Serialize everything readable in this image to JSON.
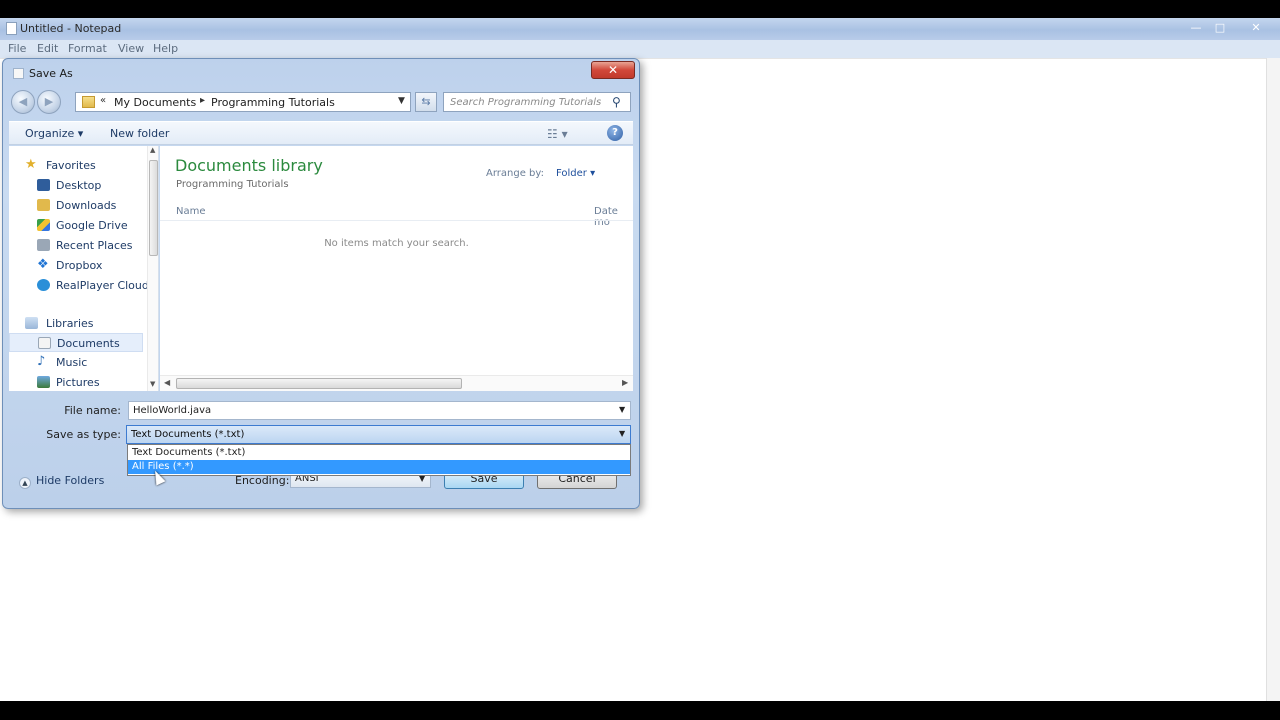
{
  "notepad": {
    "title": "Untitled - Notepad",
    "menu": [
      "File",
      "Edit",
      "Format",
      "View",
      "Help"
    ],
    "window_controls": {
      "minimize": "—",
      "maximize": "□",
      "close": "✕"
    }
  },
  "dialog": {
    "title": "Save As",
    "close_label": "✕",
    "address": {
      "prefix": "«",
      "segments": [
        "My Documents",
        "Programming Tutorials"
      ]
    },
    "search": {
      "placeholder": "Search Programming Tutorials"
    },
    "toolbar": {
      "organize": "Organize ▾",
      "new_folder": "New folder"
    },
    "nav": {
      "favorites_header": "Favorites",
      "favorites": [
        "Desktop",
        "Downloads",
        "Google Drive",
        "Recent Places",
        "Dropbox",
        "RealPlayer Cloud"
      ],
      "libraries_header": "Libraries",
      "libraries": [
        "Documents",
        "Music",
        "Pictures"
      ],
      "selected": "Documents"
    },
    "content": {
      "library_title": "Documents library",
      "library_subtitle": "Programming Tutorials",
      "arrange_label": "Arrange by:",
      "arrange_value": "Folder ▾",
      "columns": [
        "Name",
        "Date mo"
      ],
      "empty_message": "No items match your search."
    },
    "fields": {
      "file_name_label": "File name:",
      "file_name_value": "HelloWorld.java",
      "save_type_label": "Save as type:",
      "save_type_value": "Text Documents (*.txt)",
      "save_type_options": [
        "Text Documents (*.txt)",
        "All Files (*.*)"
      ],
      "highlighted_option": "All Files (*.*)"
    },
    "footer": {
      "hide_folders": "Hide Folders",
      "encoding_label": "Encoding:",
      "encoding_value": "ANSI",
      "save_label": "Save",
      "cancel_label": "Cancel"
    }
  },
  "colors": {
    "accent": "#3399ff",
    "library_title": "#2b8a3e",
    "link": "#1e3b66"
  }
}
